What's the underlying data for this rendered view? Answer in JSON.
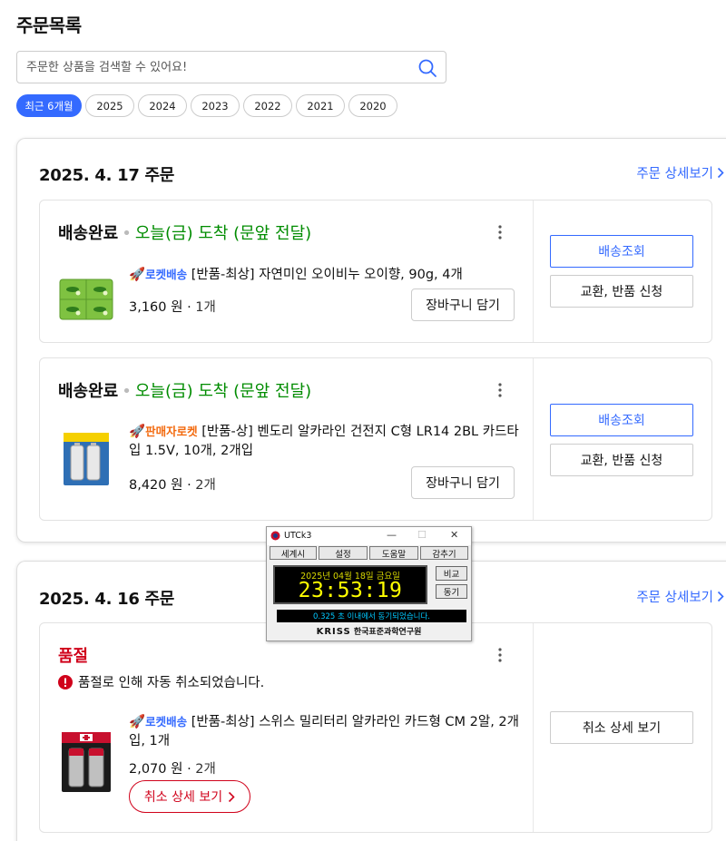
{
  "page": {
    "title": "주문목록"
  },
  "search": {
    "placeholder": "주문한 상품을 검색할 수 있어요!"
  },
  "year_filters": [
    "최근 6개월",
    "2025",
    "2024",
    "2023",
    "2022",
    "2021",
    "2020"
  ],
  "year_filter_selected": "최근 6개월",
  "colors": {
    "accent": "#346aff",
    "arrival_green": "#008c00",
    "cancel_red": "#d0021b",
    "seller_orange": "#f36a0e"
  },
  "orders": [
    {
      "date": "2025. 4. 17 주문",
      "detail_link": "주문 상세보기",
      "items": [
        {
          "status": "배송완료",
          "arrival": "오늘(금) 도착 (문앞 전달)",
          "badge": "로켓배송",
          "title": "[반품-최상] 자연미인 오이비누 오이향, 90g, 4개",
          "price": "3,160 원",
          "qty": "1개",
          "cart_button": "장바구니 담기",
          "track_button": "배송조회",
          "return_button": "교환, 반품 신청",
          "thumb_icon": "cucumber-soap-icon"
        },
        {
          "status": "배송완료",
          "arrival": "오늘(금) 도착 (문앞 전달)",
          "badge": "판매자로켓",
          "title": "[반품-상] 벤도리 알카라인 건전지 C형 LR14 2BL 카드타입 1.5V, 10개, 2개입",
          "price": "8,420 원",
          "qty": "2개",
          "cart_button": "장바구니 담기",
          "track_button": "배송조회",
          "return_button": "교환, 반품 신청",
          "thumb_icon": "battery-pack-icon"
        }
      ]
    },
    {
      "date": "2025. 4. 16 주문",
      "detail_link": "주문 상세보기",
      "items": [
        {
          "status": "품절",
          "cancel_note": "품절로 인해 자동 취소되었습니다.",
          "badge": "로켓배송",
          "title": "[반품-최상] 스위스 밀리터리 알카라인 카드형 CM 2알, 2개입, 1개",
          "price": "2,070 원",
          "qty": "2개",
          "cancel_detail_button": "취소 상세 보기",
          "side_button": "취소 상세 보기",
          "thumb_icon": "battery-pack-icon"
        }
      ]
    }
  ],
  "utck3": {
    "title": "UTCk3",
    "menu": [
      "세계시",
      "설정",
      "도움말",
      "감추기"
    ],
    "date": "2025년 04월 18일 금요일",
    "time": "23:53:19",
    "compare_button": "비교",
    "sync_button": "동기",
    "status": "0.325 초 이내에서 동기되었습니다.",
    "logo": "KRISS",
    "institute": "한국표준과학연구원"
  }
}
